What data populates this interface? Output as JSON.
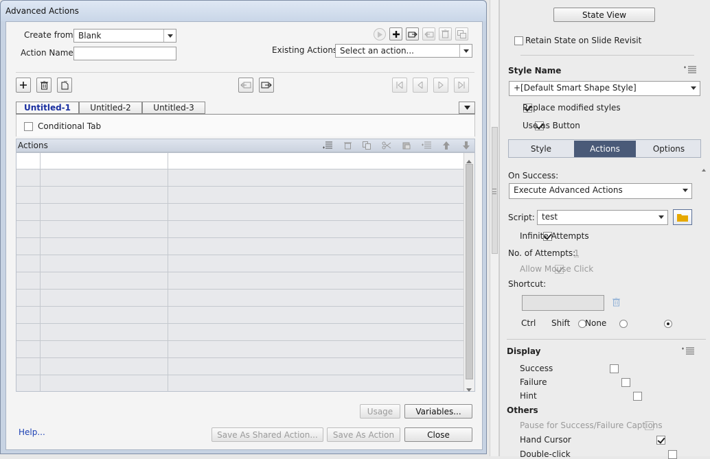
{
  "dialog": {
    "title": "Advanced Actions",
    "create_from_label": "Create from:",
    "create_from_value": "Blank",
    "action_name_label": "Action Name:",
    "action_name_value": "",
    "existing_actions_label": "Existing Actions:",
    "existing_actions_value": "Select an action...",
    "tabs": [
      "Untitled-1",
      "Untitled-2",
      "Untitled-3"
    ],
    "conditional_tab_label": "Conditional Tab",
    "actions_header": "Actions",
    "usage_button": "Usage",
    "variables_button": "Variables...",
    "help_link": "Help...",
    "save_shared_button": "Save As Shared Action...",
    "save_action_button": "Save As Action",
    "close_button": "Close"
  },
  "panel": {
    "state_view_button": "State View",
    "retain_state_label": "Retain State on Slide Revisit",
    "style_name_heading": "Style Name",
    "style_name_value": "+[Default Smart Shape Style]",
    "replace_styles_label": "Replace modified styles",
    "use_as_button_label": "Use as Button",
    "segments": [
      "Style",
      "Actions",
      "Options"
    ],
    "on_success_label": "On Success:",
    "on_success_value": "Execute Advanced Actions",
    "script_label": "Script:",
    "script_value": "test",
    "infinite_attempts_label": "Infinite Attempts",
    "attempts_label": "No. of Attempts:",
    "attempts_value": "1",
    "allow_mouse_label": "Allow Mouse Click",
    "shortcut_label": "Shortcut:",
    "ctrl_label": "Ctrl",
    "shift_label": "Shift",
    "none_label": "None",
    "display_heading": "Display",
    "success_label": "Success",
    "failure_label": "Failure",
    "hint_label": "Hint",
    "others_heading": "Others",
    "pause_label": "Pause for Success/Failure Captions",
    "hand_cursor_label": "Hand Cursor",
    "double_click_label": "Double-click"
  },
  "colors": {
    "active_segment": "#4a5a78",
    "active_tab_text": "#1a2fa0",
    "folder_icon": "#e6a800"
  }
}
